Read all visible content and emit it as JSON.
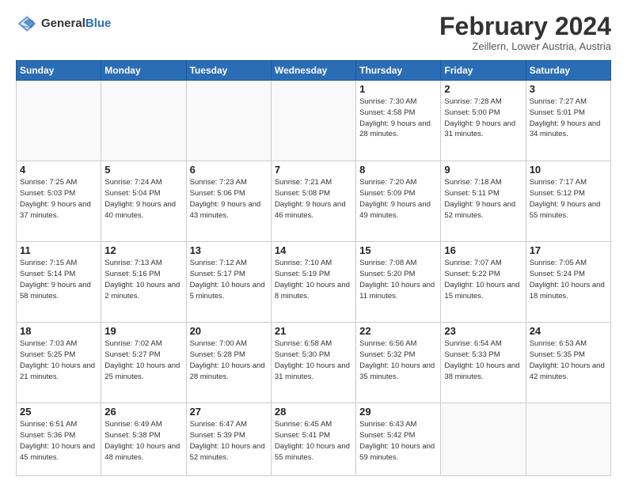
{
  "header": {
    "logo_general": "General",
    "logo_blue": "Blue",
    "month_year": "February 2024",
    "location": "Zeillern, Lower Austria, Austria"
  },
  "weekdays": [
    "Sunday",
    "Monday",
    "Tuesday",
    "Wednesday",
    "Thursday",
    "Friday",
    "Saturday"
  ],
  "weeks": [
    [
      {
        "day": "",
        "empty": true
      },
      {
        "day": "",
        "empty": true
      },
      {
        "day": "",
        "empty": true
      },
      {
        "day": "",
        "empty": true
      },
      {
        "day": "1",
        "sunrise": "7:30 AM",
        "sunset": "4:58 PM",
        "daylight": "9 hours and 28 minutes."
      },
      {
        "day": "2",
        "sunrise": "7:28 AM",
        "sunset": "5:00 PM",
        "daylight": "9 hours and 31 minutes."
      },
      {
        "day": "3",
        "sunrise": "7:27 AM",
        "sunset": "5:01 PM",
        "daylight": "9 hours and 34 minutes."
      }
    ],
    [
      {
        "day": "4",
        "sunrise": "7:25 AM",
        "sunset": "5:03 PM",
        "daylight": "9 hours and 37 minutes."
      },
      {
        "day": "5",
        "sunrise": "7:24 AM",
        "sunset": "5:04 PM",
        "daylight": "9 hours and 40 minutes."
      },
      {
        "day": "6",
        "sunrise": "7:23 AM",
        "sunset": "5:06 PM",
        "daylight": "9 hours and 43 minutes."
      },
      {
        "day": "7",
        "sunrise": "7:21 AM",
        "sunset": "5:08 PM",
        "daylight": "9 hours and 46 minutes."
      },
      {
        "day": "8",
        "sunrise": "7:20 AM",
        "sunset": "5:09 PM",
        "daylight": "9 hours and 49 minutes."
      },
      {
        "day": "9",
        "sunrise": "7:18 AM",
        "sunset": "5:11 PM",
        "daylight": "9 hours and 52 minutes."
      },
      {
        "day": "10",
        "sunrise": "7:17 AM",
        "sunset": "5:12 PM",
        "daylight": "9 hours and 55 minutes."
      }
    ],
    [
      {
        "day": "11",
        "sunrise": "7:15 AM",
        "sunset": "5:14 PM",
        "daylight": "9 hours and 58 minutes."
      },
      {
        "day": "12",
        "sunrise": "7:13 AM",
        "sunset": "5:16 PM",
        "daylight": "10 hours and 2 minutes."
      },
      {
        "day": "13",
        "sunrise": "7:12 AM",
        "sunset": "5:17 PM",
        "daylight": "10 hours and 5 minutes."
      },
      {
        "day": "14",
        "sunrise": "7:10 AM",
        "sunset": "5:19 PM",
        "daylight": "10 hours and 8 minutes."
      },
      {
        "day": "15",
        "sunrise": "7:08 AM",
        "sunset": "5:20 PM",
        "daylight": "10 hours and 11 minutes."
      },
      {
        "day": "16",
        "sunrise": "7:07 AM",
        "sunset": "5:22 PM",
        "daylight": "10 hours and 15 minutes."
      },
      {
        "day": "17",
        "sunrise": "7:05 AM",
        "sunset": "5:24 PM",
        "daylight": "10 hours and 18 minutes."
      }
    ],
    [
      {
        "day": "18",
        "sunrise": "7:03 AM",
        "sunset": "5:25 PM",
        "daylight": "10 hours and 21 minutes."
      },
      {
        "day": "19",
        "sunrise": "7:02 AM",
        "sunset": "5:27 PM",
        "daylight": "10 hours and 25 minutes."
      },
      {
        "day": "20",
        "sunrise": "7:00 AM",
        "sunset": "5:28 PM",
        "daylight": "10 hours and 28 minutes."
      },
      {
        "day": "21",
        "sunrise": "6:58 AM",
        "sunset": "5:30 PM",
        "daylight": "10 hours and 31 minutes."
      },
      {
        "day": "22",
        "sunrise": "6:56 AM",
        "sunset": "5:32 PM",
        "daylight": "10 hours and 35 minutes."
      },
      {
        "day": "23",
        "sunrise": "6:54 AM",
        "sunset": "5:33 PM",
        "daylight": "10 hours and 38 minutes."
      },
      {
        "day": "24",
        "sunrise": "6:53 AM",
        "sunset": "5:35 PM",
        "daylight": "10 hours and 42 minutes."
      }
    ],
    [
      {
        "day": "25",
        "sunrise": "6:51 AM",
        "sunset": "5:36 PM",
        "daylight": "10 hours and 45 minutes."
      },
      {
        "day": "26",
        "sunrise": "6:49 AM",
        "sunset": "5:38 PM",
        "daylight": "10 hours and 48 minutes."
      },
      {
        "day": "27",
        "sunrise": "6:47 AM",
        "sunset": "5:39 PM",
        "daylight": "10 hours and 52 minutes."
      },
      {
        "day": "28",
        "sunrise": "6:45 AM",
        "sunset": "5:41 PM",
        "daylight": "10 hours and 55 minutes."
      },
      {
        "day": "29",
        "sunrise": "6:43 AM",
        "sunset": "5:42 PM",
        "daylight": "10 hours and 59 minutes."
      },
      {
        "day": "",
        "empty": true
      },
      {
        "day": "",
        "empty": true
      }
    ]
  ],
  "labels": {
    "sunrise_prefix": "Sunrise: ",
    "sunset_prefix": "Sunset: ",
    "daylight_prefix": "Daylight: "
  }
}
